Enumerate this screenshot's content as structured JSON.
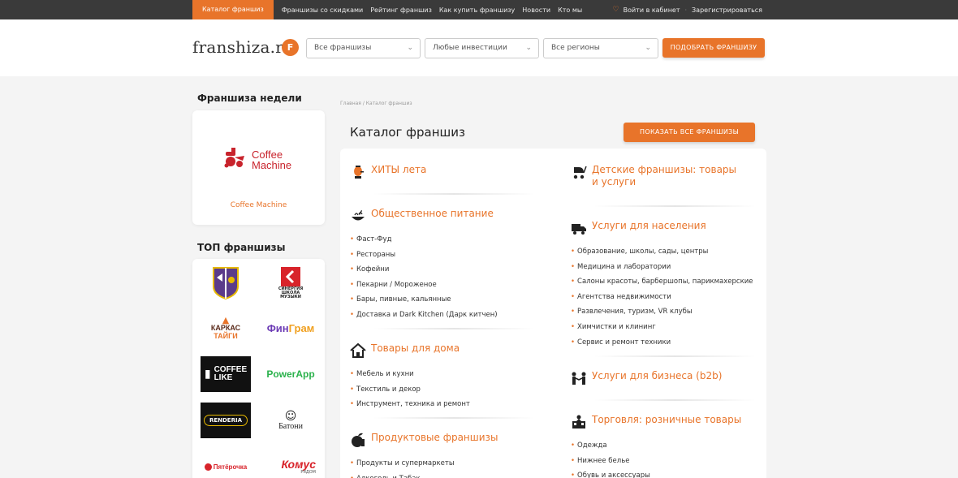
{
  "topnav": {
    "items": [
      {
        "label": "Каталог франшиз",
        "active": true
      },
      {
        "label": "Франшизы со скидками"
      },
      {
        "label": "Рейтинг франшиз"
      },
      {
        "label": "Как купить франшизу"
      },
      {
        "label": "Новости"
      },
      {
        "label": "Кто мы"
      }
    ],
    "login": "Войти в кабинет",
    "register": "Зарегистрироваться"
  },
  "header": {
    "logo": "franshiza.ru",
    "logo_badge": "F",
    "filters": [
      {
        "value": "Все франшизы"
      },
      {
        "value": "Любые инвестиции"
      },
      {
        "value": "Все регионы"
      }
    ],
    "search_button": "ПОДОБРАТЬ ФРАНШИЗУ"
  },
  "sidebar": {
    "week_title": "Франшиза недели",
    "week_logo_text_1": "Coffee",
    "week_logo_text_2": "Machine",
    "week_name": "Coffee Machine",
    "top_title": "ТОП франшизы",
    "top_logos": [
      {
        "name": "Shield brand"
      },
      {
        "name": "Синергия школа музыки",
        "l1": "СИНЕРГИЯ",
        "l2": "ШКОЛА",
        "l3": "МУЗЫКИ"
      },
      {
        "name": "Каркас Тайги",
        "l1": "КАРКАС",
        "l2": "ТАЙГИ"
      },
      {
        "name": "ФинГрам",
        "l1": "Фин",
        "l2": "Грам"
      },
      {
        "name": "Coffee Like",
        "l1": "COFFEE",
        "l2": "LIKE"
      },
      {
        "name": "PowerApp",
        "text": "PowerApp"
      },
      {
        "name": "Renderia",
        "text": "RENDERIA"
      },
      {
        "name": "Батони",
        "text": "Батони"
      },
      {
        "name": "Пятёрочка",
        "text": "Пятёрочка"
      },
      {
        "name": "Комус",
        "text": "Комус",
        "sub": "РЯДОМ"
      }
    ]
  },
  "main": {
    "breadcrumb": "Главная / Каталог франшиз",
    "title": "Каталог франшиз",
    "show_all": "ПОКАЗАТЬ ВСЕ ФРАНШИЗЫ",
    "categories_left": [
      {
        "icon": "samovar-icon",
        "title": "ХИТЫ лета",
        "items": []
      },
      {
        "icon": "food-bowl-icon",
        "title": "Общественное питание",
        "items": [
          "Фаст-Фуд",
          "Рестораны",
          "Кофейни",
          "Пекарни / Мороженое",
          "Бары, пивные, кальянные",
          "Доставка и Dark Kitchen (Дарк китчен)"
        ]
      },
      {
        "icon": "house-icon",
        "title": "Товары для дома",
        "items": [
          "Мебель и кухни",
          "Текстиль и декор",
          "Инструмент, техника и ремонт"
        ]
      },
      {
        "icon": "grocery-icon",
        "title": "Продуктовые франшизы",
        "items": [
          "Продукты и супермаркеты",
          "Алкоголь и Табак"
        ]
      }
    ],
    "categories_right": [
      {
        "icon": "stroller-icon",
        "title": "Детские франшизы: товары и услуги",
        "items": []
      },
      {
        "icon": "truck-icon",
        "title": "Услуги для населения",
        "items": [
          "Образование, школы, сады, центры",
          "Медицина и лаборатории",
          "Салоны красоты, барбершопы, парикмахерские",
          "Агентства недвижимости",
          "Развлечения, туризм, VR клубы",
          "Химчистки и клининг",
          "Сервис и ремонт техники"
        ]
      },
      {
        "icon": "handshake-icon",
        "title": "Услуги для бизнеса (b2b)",
        "items": []
      },
      {
        "icon": "shop-icon",
        "title": "Торговля: розничные товары",
        "items": [
          "Одежда",
          "Нижнее белье",
          "Обувь и аксессуары"
        ]
      }
    ]
  }
}
